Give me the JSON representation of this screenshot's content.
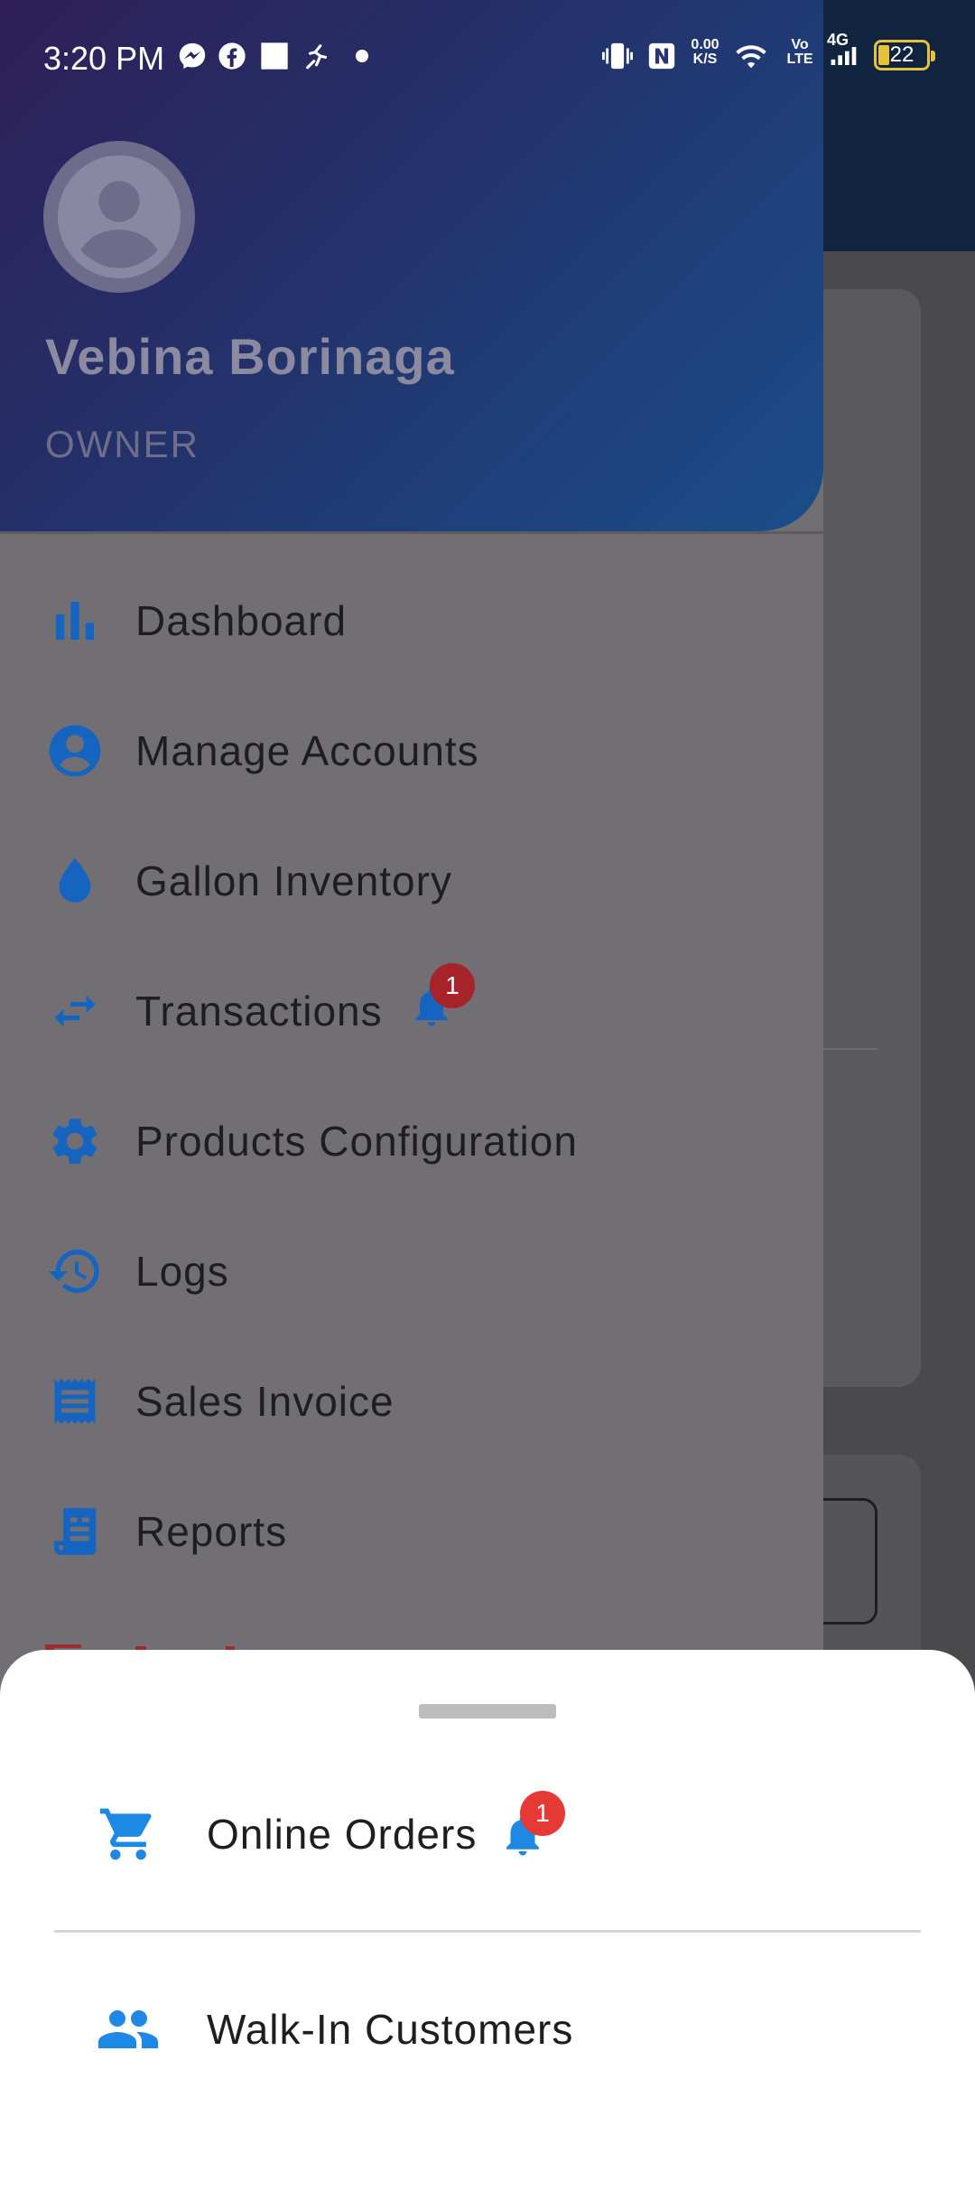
{
  "status_bar": {
    "time": "3:20 PM",
    "net_speed_value": "0.00",
    "net_speed_unit": "K/S",
    "volte_top": "Vo",
    "volte_bottom": "LTE",
    "network": "4G",
    "battery": "22"
  },
  "drawer": {
    "user_name": "Vebina Borinaga",
    "user_role": "OWNER",
    "items": [
      {
        "label": "Dashboard",
        "icon": "bar-chart-icon"
      },
      {
        "label": "Manage Accounts",
        "icon": "account-circle-icon"
      },
      {
        "label": "Gallon Inventory",
        "icon": "water-drop-icon"
      },
      {
        "label": "Transactions",
        "icon": "swap-arrows-icon",
        "badge": "1"
      },
      {
        "label": "Products Configuration",
        "icon": "gear-icon"
      },
      {
        "label": "Logs",
        "icon": "history-icon"
      },
      {
        "label": "Sales Invoice",
        "icon": "receipt-icon"
      },
      {
        "label": "Reports",
        "icon": "report-icon"
      }
    ]
  },
  "sheet": {
    "items": [
      {
        "label": "Online Orders",
        "icon": "cart-icon",
        "badge": "1"
      },
      {
        "label": "Walk-In Customers",
        "icon": "people-icon"
      }
    ]
  },
  "colors": {
    "accent": "#1565c0",
    "sheet_accent": "#1e88e5",
    "badge_dark": "#a6232a",
    "badge_bright": "#e53935"
  }
}
